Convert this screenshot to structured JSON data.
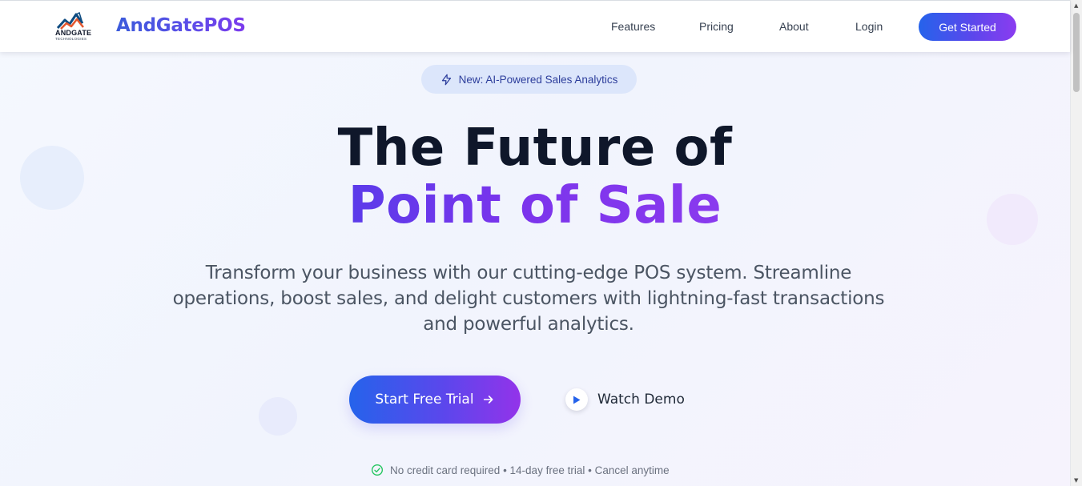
{
  "header": {
    "logo_text": "ANDGATE",
    "logo_subtext": "TECHNOLOGIES",
    "brand": "AndGatePOS",
    "nav": [
      "Features",
      "Pricing",
      "About",
      "Login"
    ],
    "cta_label": "Get Started"
  },
  "badge": {
    "icon": "lightning-icon",
    "text": "New: AI-Powered Sales Analytics"
  },
  "hero": {
    "title_line1": "The Future of",
    "title_line2": "Point of Sale",
    "subtitle": "Transform your business with our cutting-edge POS system. Streamline operations, boost sales, and delight customers with lightning-fast transactions and powerful analytics."
  },
  "actions": {
    "primary_label": "Start Free Trial",
    "primary_icon": "arrow-right-icon",
    "secondary_label": "Watch Demo",
    "secondary_icon": "play-icon"
  },
  "fine_print": {
    "icon": "check-circle-icon",
    "text": "No credit card required • 14-day free trial • Cancel anytime"
  },
  "colors": {
    "brand_blue": "#2563eb",
    "brand_purple": "#8b3cf0",
    "heading_dark": "#0f172a",
    "badge_bg": "#dce6fb",
    "check_green": "#22c55e"
  }
}
